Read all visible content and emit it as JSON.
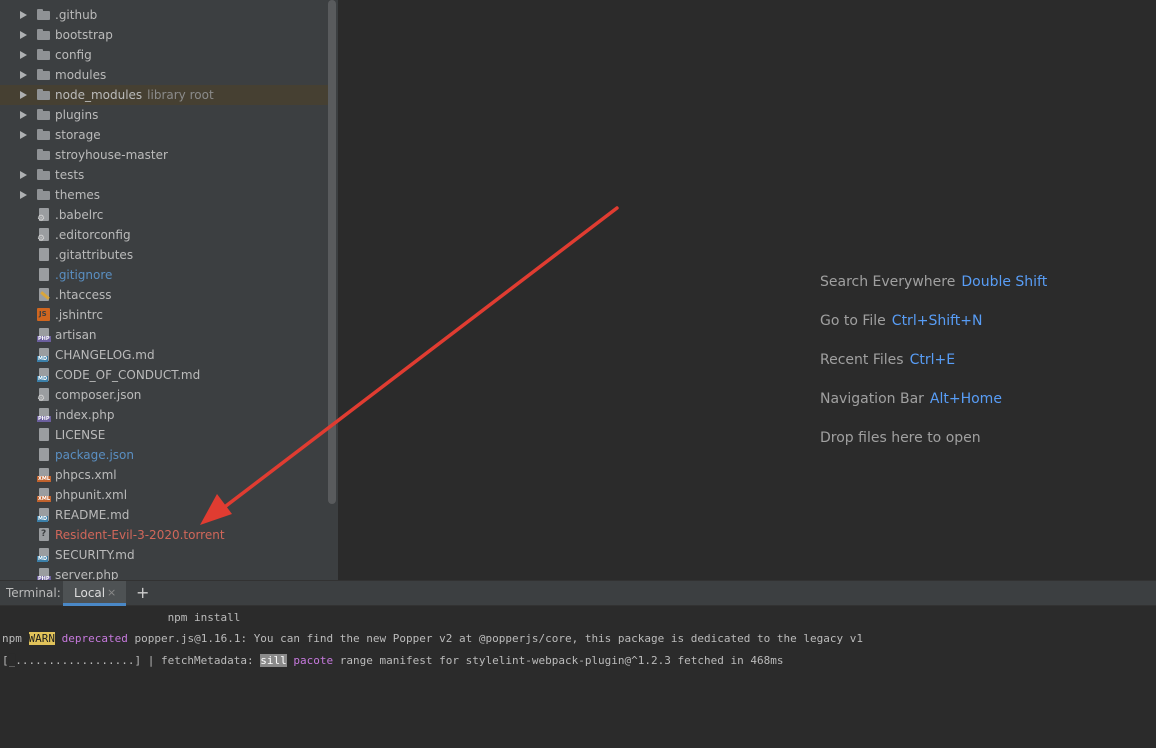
{
  "tree": {
    "items": [
      {
        "label": ".github",
        "kind": "folder",
        "expandable": true
      },
      {
        "label": "bootstrap",
        "kind": "folder",
        "expandable": true
      },
      {
        "label": "config",
        "kind": "folder",
        "expandable": true
      },
      {
        "label": "modules",
        "kind": "folder",
        "expandable": true
      },
      {
        "label": "node_modules",
        "hint": "library root",
        "kind": "folder",
        "expandable": true,
        "selected": true
      },
      {
        "label": "plugins",
        "kind": "folder",
        "expandable": true
      },
      {
        "label": "storage",
        "kind": "folder",
        "expandable": true
      },
      {
        "label": "stroyhouse-master",
        "kind": "folder",
        "expandable": false
      },
      {
        "label": "tests",
        "kind": "folder",
        "expandable": true
      },
      {
        "label": "themes",
        "kind": "folder",
        "expandable": true
      },
      {
        "label": ".babelrc",
        "kind": "config-file"
      },
      {
        "label": ".editorconfig",
        "kind": "config-file"
      },
      {
        "label": ".gitattributes",
        "kind": "text-file"
      },
      {
        "label": ".gitignore",
        "kind": "text-file",
        "status": "ignored"
      },
      {
        "label": ".htaccess",
        "kind": "htaccess-file"
      },
      {
        "label": ".jshintrc",
        "kind": "js-file",
        "tag": "JS"
      },
      {
        "label": "artisan",
        "kind": "php-file",
        "tag": "PHP"
      },
      {
        "label": "CHANGELOG.md",
        "kind": "md-file",
        "tag": "MD"
      },
      {
        "label": "CODE_OF_CONDUCT.md",
        "kind": "md-file",
        "tag": "MD"
      },
      {
        "label": "composer.json",
        "kind": "config-file"
      },
      {
        "label": "index.php",
        "kind": "php-file",
        "tag": "PHP"
      },
      {
        "label": "LICENSE",
        "kind": "text-file"
      },
      {
        "label": "package.json",
        "kind": "json-file",
        "status": "ignored"
      },
      {
        "label": "phpcs.xml",
        "kind": "xml-file",
        "tag": "XML"
      },
      {
        "label": "phpunit.xml",
        "kind": "xml-file",
        "tag": "XML"
      },
      {
        "label": "README.md",
        "kind": "md-file",
        "tag": "MD"
      },
      {
        "label": "Resident-Evil-3-2020.torrent",
        "kind": "unknown-file",
        "status": "unversioned"
      },
      {
        "label": "SECURITY.md",
        "kind": "md-file",
        "tag": "MD"
      },
      {
        "label": "server.php",
        "kind": "php-file",
        "tag": "PHP"
      }
    ]
  },
  "editor": {
    "hints": [
      {
        "label": "Search Everywhere",
        "shortcut": "Double Shift"
      },
      {
        "label": "Go to File",
        "shortcut": "Ctrl+Shift+N"
      },
      {
        "label": "Recent Files",
        "shortcut": "Ctrl+E"
      },
      {
        "label": "Navigation Bar",
        "shortcut": "Alt+Home"
      },
      {
        "label": "Drop files here to open",
        "shortcut": ""
      }
    ],
    "annotation_color": "#e03c31"
  },
  "terminal": {
    "title": "Terminal:",
    "tab_label": "Local",
    "close_glyph": "×",
    "new_tab_glyph": "+",
    "lines": {
      "cmd": "                         npm install",
      "warn_prefix": "npm ",
      "warn_badge": "WARN",
      "warn_deprecated": " deprecated",
      "warn_text": " popper.js@1.16.1: You can find the new Popper v2 at @popperjs/core, this package is dedicated to the legacy v1",
      "progress_open": "[",
      "progress_cursor": "█",
      "progress_rest": "..................] | fetchMetadata: ",
      "progress_sill": "sill",
      "progress_pacote": " pacote",
      "progress_text": " range manifest for stylelint-webpack-plugin@^1.2.3 fetched in 468ms"
    }
  },
  "colors": {
    "panel_bg": "#3c3f41",
    "editor_bg": "#2b2b2b",
    "link_blue": "#589df6",
    "ignored_blue": "#5a8fc2",
    "unversioned_red": "#d1675a",
    "warn_yellow": "#e0c25a"
  }
}
